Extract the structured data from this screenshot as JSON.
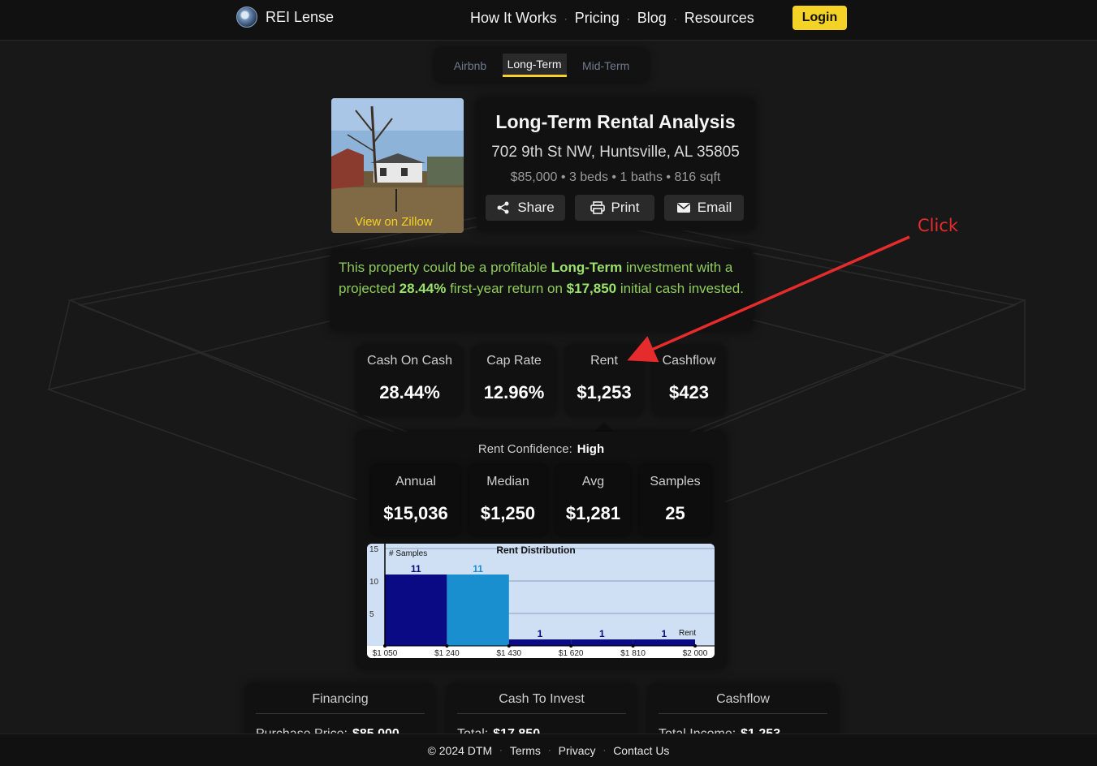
{
  "header": {
    "brand": "REI Lense",
    "nav": [
      "How It Works",
      "Pricing",
      "Blog",
      "Resources"
    ],
    "login": "Login"
  },
  "tabs": [
    "Airbnb",
    "Long-Term",
    "Mid-Term"
  ],
  "active_tab": "Long-Term",
  "property": {
    "zillow_link": "View on Zillow",
    "title": "Long-Term Rental Analysis",
    "address": "702 9th St NW, Huntsville, AL 35805",
    "details": "$85,000 • 3 beds • 1 baths • 816 sqft",
    "share": "Share",
    "print": "Print",
    "email": "Email"
  },
  "summary": {
    "p1": "This property could be a profitable ",
    "b1": "Long-Term",
    "p2": " investment with a projected ",
    "b2": "28.44%",
    "p3": " first-year return on ",
    "b3": "$17,850",
    "p4": " initial cash invested."
  },
  "metrics": [
    {
      "label": "Cash On Cash",
      "value": "28.44%"
    },
    {
      "label": "Cap Rate",
      "value": "12.96%"
    },
    {
      "label": "Rent",
      "value": "$1,253"
    },
    {
      "label": "Cashflow",
      "value": "$423"
    }
  ],
  "rent_details": {
    "confidence_label": "Rent Confidence:",
    "confidence_value": "High",
    "stats": [
      {
        "label": "Annual",
        "value": "$15,036"
      },
      {
        "label": "Median",
        "value": "$1,250"
      },
      {
        "label": "Avg",
        "value": "$1,281"
      },
      {
        "label": "Samples",
        "value": "25"
      }
    ]
  },
  "chart_data": {
    "type": "bar",
    "title": "Rent Distribution",
    "ylabel": "# Samples",
    "xlabel": "Rent",
    "x_ticks": [
      "$1 050",
      "$1 240",
      "$1 430",
      "$1 620",
      "$1 810",
      "$2 000"
    ],
    "y_ticks": [
      5,
      10,
      15
    ],
    "ylim": [
      0,
      15
    ],
    "bins": [
      {
        "from": 1050,
        "to": 1240,
        "value": 11,
        "color": "#0a0a84"
      },
      {
        "from": 1240,
        "to": 1430,
        "value": 11,
        "color": "#1a8fd0"
      },
      {
        "from": 1430,
        "to": 1620,
        "value": 1,
        "color": "#0a0a84"
      },
      {
        "from": 1620,
        "to": 1810,
        "value": 1,
        "color": "#0a0a84"
      },
      {
        "from": 1810,
        "to": 2000,
        "value": 1,
        "color": "#0a0a84"
      }
    ]
  },
  "annotation": {
    "text": "Click"
  },
  "bottom_cards": [
    {
      "title": "Financing",
      "row_label": "Purchase Price:",
      "row_value": "$85,000"
    },
    {
      "title": "Cash To Invest",
      "row_label": "Total:",
      "row_value": "$17,850"
    },
    {
      "title": "Cashflow",
      "row_label": "Total Income:",
      "row_value": "$1,253"
    }
  ],
  "footer": {
    "copyright": "© 2024 DTM",
    "links": [
      "Terms",
      "Privacy",
      "Contact Us"
    ]
  },
  "colors": {
    "accent": "#f5d226",
    "positive": "#8fcc5b",
    "annotation": "#e52b2b"
  }
}
